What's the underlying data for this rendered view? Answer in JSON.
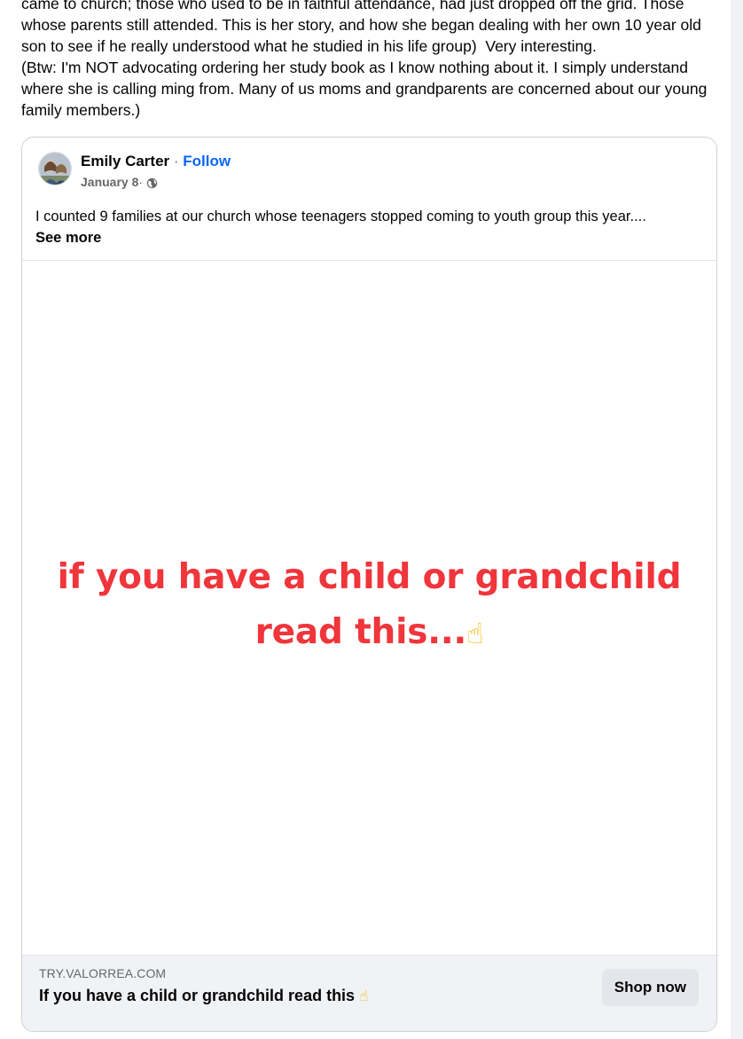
{
  "post": {
    "text": "came to church; those who used to be in faithful attendance, had just dropped off the grid. Those whose parents still attended. This is her story, and how she began dealing with her own 10 year old son to see if he really understood what he studied in his life group)  Very interesting.\n(Btw: I'm NOT advocating ordering her study book as I know nothing about it. I simply understand where she is calling ming from. Many of us moms and grandparents are concerned about our young family members.)"
  },
  "shared_post": {
    "author": "Emily Carter",
    "separator": " · ",
    "follow_label": "Follow",
    "date": "January 8",
    "meta_separator": " · ",
    "privacy_icon": "globe-icon",
    "body": "I counted 9 families at our church whose teenagers stopped coming to youth group this year....",
    "see_more_label": "See more"
  },
  "ad": {
    "image_line1": "if you have a child or grandchild",
    "image_line2": "read this...",
    "image_emoji": "☝",
    "domain": "TRY.VALORREA.COM",
    "title": "If you have a child or grandchild read this ",
    "title_emoji": "☝",
    "cta_label": "Shop now"
  },
  "colors": {
    "link": "#0866ff",
    "headline_red": "#f0353b",
    "footer_bg": "#f0f2f5",
    "button_bg": "#e4e6eb"
  }
}
